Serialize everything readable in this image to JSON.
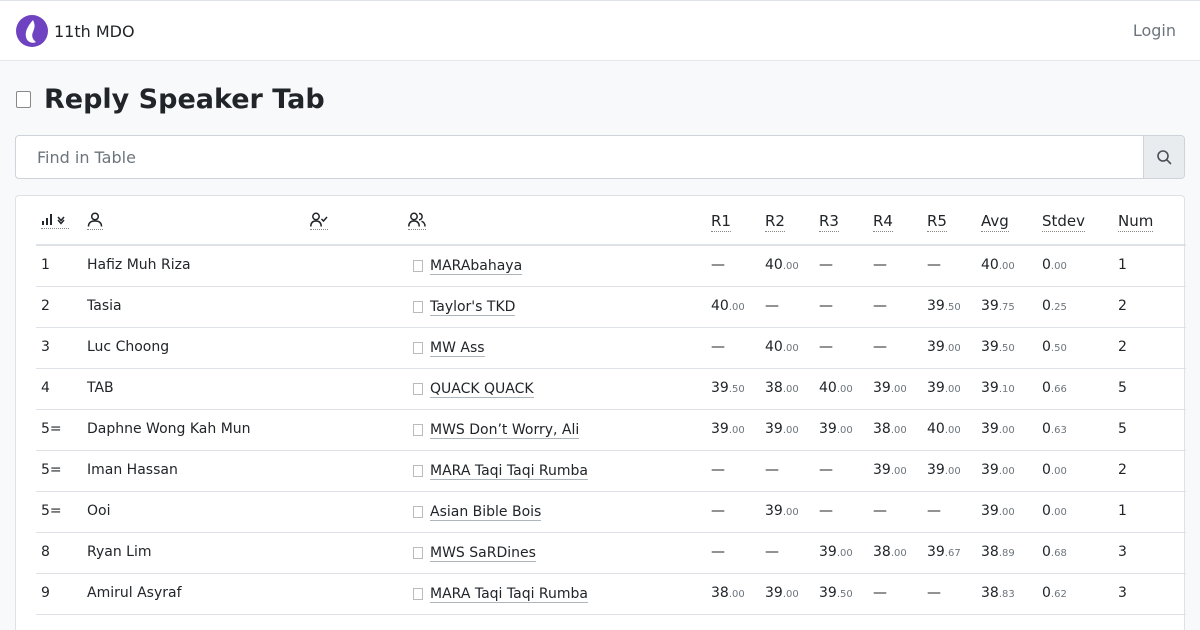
{
  "brand": {
    "name": "11th MDO"
  },
  "nav": {
    "login": "Login"
  },
  "page": {
    "title": "Reply Speaker Tab"
  },
  "search": {
    "placeholder": "Find in Table"
  },
  "columns": [
    "R1",
    "R2",
    "R3",
    "R4",
    "R5",
    "Avg",
    "Stdev",
    "Num"
  ],
  "rows": [
    {
      "rank": "1",
      "name": "Hafiz Muh Riza",
      "team": "MARAbahaya",
      "scores": [
        null,
        "40.00",
        null,
        null,
        null
      ],
      "avg": "40.00",
      "stdev": "0.00",
      "num": "1"
    },
    {
      "rank": "2",
      "name": "Tasia",
      "team": "Taylor's TKD",
      "scores": [
        "40.00",
        null,
        null,
        null,
        "39.50"
      ],
      "avg": "39.75",
      "stdev": "0.25",
      "num": "2"
    },
    {
      "rank": "3",
      "name": "Luc Choong",
      "team": "MW Ass",
      "scores": [
        null,
        "40.00",
        null,
        null,
        "39.00"
      ],
      "avg": "39.50",
      "stdev": "0.50",
      "num": "2"
    },
    {
      "rank": "4",
      "name": "TAB",
      "team": "QUACK QUACK",
      "scores": [
        "39.50",
        "38.00",
        "40.00",
        "39.00",
        "39.00"
      ],
      "avg": "39.10",
      "stdev": "0.66",
      "num": "5"
    },
    {
      "rank": "5=",
      "name": "Daphne Wong Kah Mun",
      "team": "MWS Don’t Worry, Ali",
      "scores": [
        "39.00",
        "39.00",
        "39.00",
        "38.00",
        "40.00"
      ],
      "avg": "39.00",
      "stdev": "0.63",
      "num": "5"
    },
    {
      "rank": "5=",
      "name": "Iman Hassan",
      "team": "MARA Taqi Taqi Rumba",
      "scores": [
        null,
        null,
        null,
        "39.00",
        "39.00"
      ],
      "avg": "39.00",
      "stdev": "0.00",
      "num": "2"
    },
    {
      "rank": "5=",
      "name": "Ooi",
      "team": "Asian Bible Bois",
      "scores": [
        null,
        "39.00",
        null,
        null,
        null
      ],
      "avg": "39.00",
      "stdev": "0.00",
      "num": "1"
    },
    {
      "rank": "8",
      "name": "Ryan Lim",
      "team": "MWS SaRDines",
      "scores": [
        null,
        null,
        "39.00",
        "38.00",
        "39.67"
      ],
      "avg": "38.89",
      "stdev": "0.68",
      "num": "3"
    },
    {
      "rank": "9",
      "name": "Amirul Asyraf",
      "team": "MARA Taqi Taqi Rumba",
      "scores": [
        "38.00",
        "39.00",
        "39.50",
        null,
        null
      ],
      "avg": "38.83",
      "stdev": "0.62",
      "num": "3"
    }
  ]
}
